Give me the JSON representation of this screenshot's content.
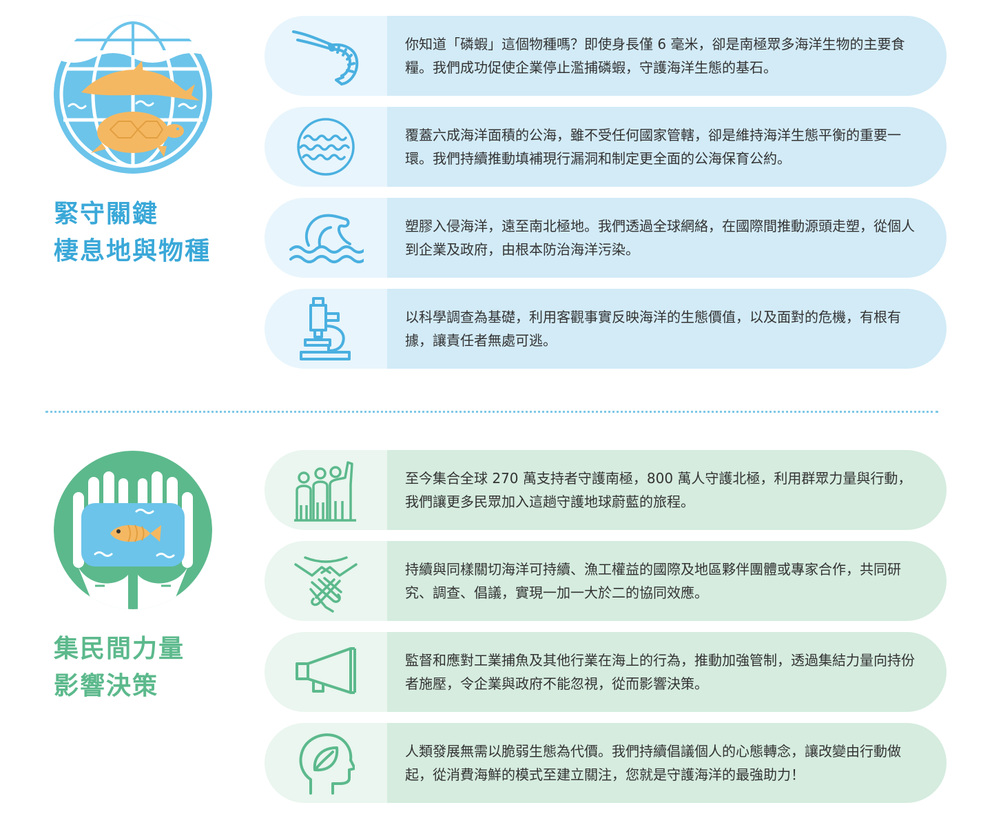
{
  "sections": [
    {
      "heading": [
        "緊守關鍵",
        "棲息地與物種"
      ],
      "accent": "#3aa8d8",
      "emblem": "globe-dolphin-turtle",
      "items": [
        {
          "icon": "shrimp-icon",
          "text": "你知道「磷蝦」這個物種嗎？即使身長僅 6 毫米，卻是南極眾多海洋生物的主要食糧。我們成功促使企業停止濫捕磷蝦，守護海洋生態的基石。"
        },
        {
          "icon": "waves-icon",
          "text": "覆蓋六成海洋面積的公海，雖不受任何國家管轄，卻是維持海洋生態平衡的重要一環。我們持續推動填補現行漏洞和制定更全面的公海保育公約。"
        },
        {
          "icon": "plastic-bag-icon",
          "text": "塑膠入侵海洋，遠至南北極地。我們透過全球網絡，在國際間推動源頭走塑，從個人到企業及政府，由根本防治海洋污染。"
        },
        {
          "icon": "microscope-icon",
          "text": "以科學調查為基礎，利用客觀事實反映海洋的生態價值，以及面對的危機，有根有據，讓責任者無處可逃。"
        }
      ]
    },
    {
      "heading": [
        "集民間力量",
        "影響決策"
      ],
      "accent": "#5cb98c",
      "emblem": "hands-fish",
      "items": [
        {
          "icon": "people-raising-hand-icon",
          "text": "至今集合全球 270 萬支持者守護南極，800 萬人守護北極，利用群眾力量與行動，我們讓更多民眾加入這趟守護地球蔚藍的旅程。"
        },
        {
          "icon": "joined-hands-icon",
          "text": "持續與同樣關切海洋可持續、漁工權益的國際及地區夥伴團體或專家合作，共同研究、調查、倡議，實現一加一大於二的協同效應。"
        },
        {
          "icon": "megaphone-icon",
          "text": "監督和應對工業捕魚及其他行業在海上的行為，推動加強管制，透過集結力量向持份者施壓，令企業與政府不能忽視，從而影響決策。"
        },
        {
          "icon": "head-leaf-icon",
          "text": "人類發展無需以脆弱生態為代價。我們持續倡議個人的心態轉念，讓改變由行動做起，從消費海鮮的模式至建立關注，您就是守護海洋的最強助力！"
        }
      ]
    }
  ]
}
